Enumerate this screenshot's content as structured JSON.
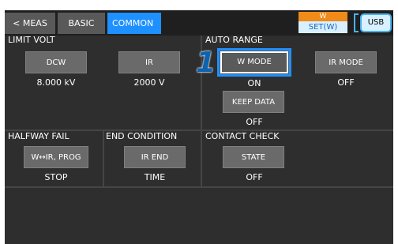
{
  "tabs": {
    "meas": "< MEAS",
    "basic": "BASIC",
    "common": "COMMON"
  },
  "status": {
    "w": "W",
    "set": "SET(W)",
    "usb": "USB"
  },
  "limit_volt": {
    "title": "LIMIT VOLT",
    "dcw_label": "DCW",
    "dcw_value": "8.000 kV",
    "ir_label": "IR",
    "ir_value": "2000 V"
  },
  "auto_range": {
    "title": "AUTO RANGE",
    "w_mode_label": "W MODE",
    "w_mode_value": "ON",
    "ir_mode_label": "IR MODE",
    "ir_mode_value": "OFF",
    "keep_data_label": "KEEP DATA",
    "keep_data_value": "OFF"
  },
  "halfway_fail": {
    "title": "HALFWAY FAIL",
    "button_label": "W↔IR, PROG",
    "value": "STOP"
  },
  "end_condition": {
    "title": "END CONDITION",
    "button_label": "IR END",
    "value": "TIME"
  },
  "contact_check": {
    "title": "CONTACT CHECK",
    "button_label": "STATE",
    "value": "OFF"
  },
  "callout": {
    "number": "1"
  },
  "colors": {
    "accent": "#1e90ff",
    "warning": "#f08a18",
    "background": "#2e2e2e",
    "callout": "#0d63b0"
  }
}
